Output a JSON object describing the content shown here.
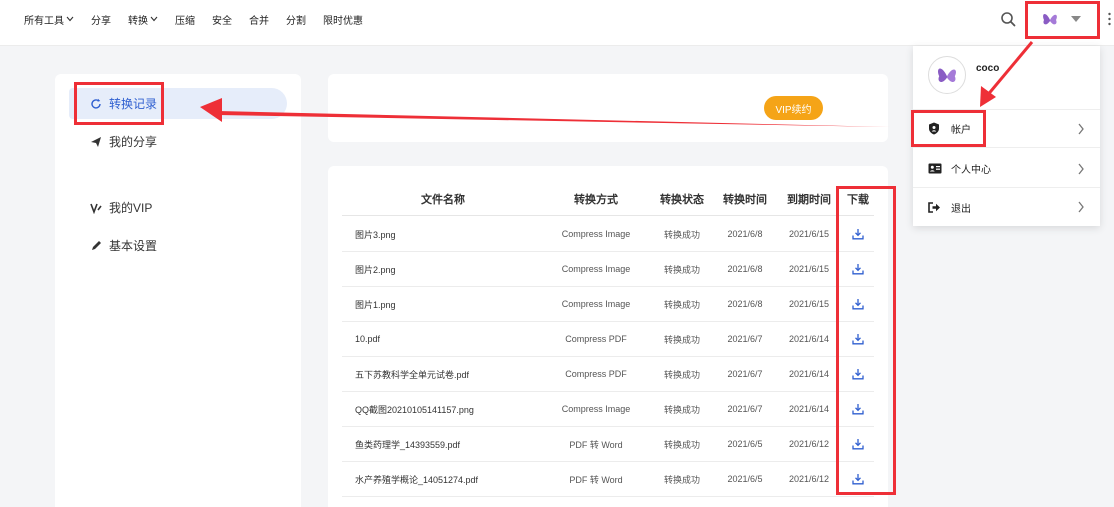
{
  "nav": {
    "items": [
      {
        "label": "所有工具",
        "dropdown": true
      },
      {
        "label": "分享",
        "dropdown": false
      },
      {
        "label": "转换",
        "dropdown": true
      },
      {
        "label": "压缩",
        "dropdown": false
      },
      {
        "label": "安全",
        "dropdown": false
      },
      {
        "label": "合并",
        "dropdown": false
      },
      {
        "label": "分割",
        "dropdown": false
      },
      {
        "label": "限时优惠",
        "dropdown": false
      }
    ]
  },
  "sidebar": {
    "items": [
      {
        "label": "转换记录",
        "icon": "refresh-icon",
        "active": true
      },
      {
        "label": "我的分享",
        "icon": "send-icon",
        "active": false
      },
      {
        "label": "我的VIP",
        "icon": "vip-icon",
        "active": false
      },
      {
        "label": "基本设置",
        "icon": "pencil-icon",
        "active": false
      }
    ]
  },
  "vip": {
    "button_label": "VIP续约"
  },
  "table": {
    "headers": {
      "name": "文件名称",
      "method": "转换方式",
      "status": "转换状态",
      "time": "转换时间",
      "expire": "到期时间",
      "download": "下载"
    },
    "rows": [
      {
        "name": "图片3.png",
        "method": "Compress Image",
        "status": "转换成功",
        "time": "2021/6/8",
        "expire": "2021/6/15"
      },
      {
        "name": "图片2.png",
        "method": "Compress Image",
        "status": "转换成功",
        "time": "2021/6/8",
        "expire": "2021/6/15"
      },
      {
        "name": "图片1.png",
        "method": "Compress Image",
        "status": "转换成功",
        "time": "2021/6/8",
        "expire": "2021/6/15"
      },
      {
        "name": "10.pdf",
        "method": "Compress PDF",
        "status": "转换成功",
        "time": "2021/6/7",
        "expire": "2021/6/14"
      },
      {
        "name": "五下苏教科学全单元试卷.pdf",
        "method": "Compress PDF",
        "status": "转换成功",
        "time": "2021/6/7",
        "expire": "2021/6/14"
      },
      {
        "name": "QQ截图20210105141157.png",
        "method": "Compress Image",
        "status": "转换成功",
        "time": "2021/6/7",
        "expire": "2021/6/14"
      },
      {
        "name": "鱼类药理学_14393559.pdf",
        "method": "PDF 转 Word",
        "status": "转换成功",
        "time": "2021/6/5",
        "expire": "2021/6/12"
      },
      {
        "name": "水产养殖学概论_14051274.pdf",
        "method": "PDF 转 Word",
        "status": "转换成功",
        "time": "2021/6/5",
        "expire": "2021/6/12"
      }
    ]
  },
  "dropdown": {
    "username": "coco",
    "items": [
      {
        "label": "帐户",
        "icon": "shield-icon"
      },
      {
        "label": "个人中心",
        "icon": "id-card-icon"
      },
      {
        "label": "退出",
        "icon": "logout-icon"
      }
    ]
  },
  "colors": {
    "accent": "#2f5fd0",
    "vip": "#f5a417",
    "annotation": "#ee2f37",
    "avatar": "#8a5cc4"
  }
}
